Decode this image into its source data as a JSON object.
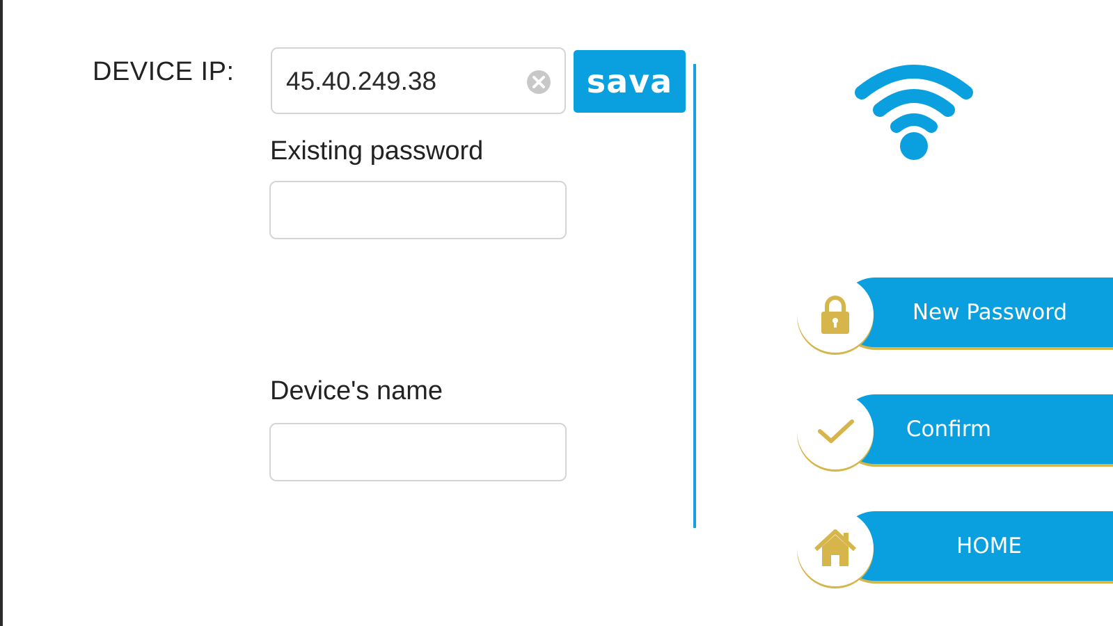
{
  "device_ip": {
    "label": "DEVICE IP:",
    "value": "45.40.249.38",
    "clear_icon": "clear-circle-icon",
    "save_label": "sava"
  },
  "existing_password": {
    "label": "Existing password",
    "value": ""
  },
  "device_name": {
    "label": "Device's name",
    "value": ""
  },
  "status_icon": "wifi-icon",
  "actions": [
    {
      "label": "New Password",
      "icon": "lock-icon"
    },
    {
      "label": "Confirm",
      "icon": "checkmark-icon"
    },
    {
      "label": "HOME",
      "icon": "home-icon"
    }
  ],
  "colors": {
    "accent": "#0aa0e0",
    "gold": "#d6b54a",
    "border": "#d4d4d4"
  }
}
